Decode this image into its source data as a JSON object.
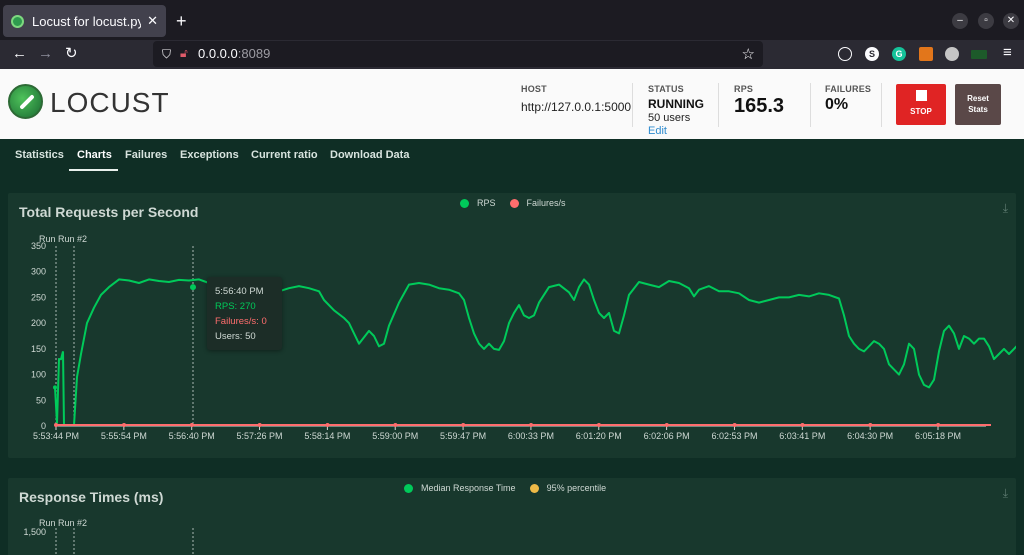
{
  "browser": {
    "tab_title": "Locust for locust.py",
    "tab_close": "✕",
    "new_tab": "+",
    "url_host": "0.0.0.0",
    "url_port": ":8089",
    "window_buttons": [
      "–",
      "▫",
      "✕"
    ]
  },
  "header": {
    "logo": "LOCUST",
    "host_label": "HOST",
    "host_value": "http://127.0.0.1:5000",
    "status_label": "STATUS",
    "status_value": "RUNNING",
    "users_value": "50 users",
    "edit_label": "Edit",
    "rps_label": "RPS",
    "rps_value": "165.3",
    "failures_label": "FAILURES",
    "failures_value": "0%",
    "stop_label": "STOP",
    "reset_label_1": "Reset",
    "reset_label_2": "Stats"
  },
  "tabs": [
    "Statistics",
    "Charts",
    "Failures",
    "Exceptions",
    "Current ratio",
    "Download Data"
  ],
  "active_tab": "Charts",
  "colors": {
    "rps": "#00ca5a",
    "failures": "#ff6d6d",
    "median": "#00ca5a",
    "p95": "#eeba47"
  },
  "chart_rps": {
    "title": "Total Requests per Second",
    "legend": [
      "RPS",
      "Failures/s"
    ],
    "markers": [
      "Run",
      "Run #2"
    ],
    "y_ticks": [
      "350",
      "300",
      "250",
      "200",
      "150",
      "100",
      "50",
      "0"
    ],
    "x_ticks": [
      "5:53:44 PM",
      "5:55:54 PM",
      "5:56:40 PM",
      "5:57:26 PM",
      "5:58:14 PM",
      "5:59:00 PM",
      "5:59:47 PM",
      "6:00:33 PM",
      "6:01:20 PM",
      "6:02:06 PM",
      "6:02:53 PM",
      "6:03:41 PM",
      "6:04:30 PM",
      "6:05:18 PM"
    ],
    "tooltip_time": "5:56:40 PM",
    "tooltip_rps": "RPS: 270",
    "tooltip_failures": "Failures/s: 0",
    "tooltip_users": "Users: 50"
  },
  "chart_data": {
    "type": "line",
    "ylim": [
      0,
      350
    ],
    "x": [
      "5:53:44 PM",
      "5:55:54 PM",
      "5:56:40 PM",
      "5:57:26 PM",
      "5:58:14 PM",
      "5:59:00 PM",
      "5:59:47 PM",
      "6:00:33 PM",
      "6:01:20 PM",
      "6:02:06 PM",
      "6:02:53 PM",
      "6:03:41 PM",
      "6:04:30 PM",
      "6:05:18 PM"
    ],
    "series": [
      {
        "name": "RPS",
        "values": [
          [
            0,
            75
          ],
          [
            1,
            5
          ],
          [
            2,
            130
          ],
          [
            3,
            130
          ],
          [
            4,
            145
          ],
          [
            5,
            2
          ],
          [
            6,
            3
          ],
          [
            7,
            2
          ],
          [
            8,
            2
          ],
          [
            9,
            2
          ],
          [
            10,
            2
          ],
          [
            11,
            2
          ],
          [
            12,
            2
          ],
          [
            13,
            2
          ],
          [
            14,
            2
          ],
          [
            15,
            2
          ],
          [
            16,
            2
          ],
          [
            17,
            2
          ],
          [
            18,
            2
          ],
          [
            19,
            2
          ],
          [
            20,
            2
          ],
          [
            21,
            2
          ],
          [
            22,
            2
          ],
          [
            23,
            2
          ],
          [
            24,
            2
          ],
          [
            25,
            2
          ],
          [
            26,
            2
          ],
          [
            27,
            2
          ],
          [
            28,
            2
          ],
          [
            29,
            2
          ],
          [
            30,
            2
          ],
          [
            31,
            2
          ],
          [
            32,
            2
          ],
          [
            33,
            2
          ],
          [
            34,
            2
          ],
          [
            35,
            2
          ],
          [
            36,
            2
          ],
          [
            37,
            2
          ],
          [
            38,
            2
          ],
          [
            39,
            2
          ],
          [
            40,
            2
          ],
          [
            41,
            2
          ],
          [
            42,
            2
          ],
          [
            43,
            2
          ],
          [
            44,
            2
          ],
          [
            45,
            2
          ],
          [
            46,
            2
          ],
          [
            47,
            2
          ],
          [
            48,
            2
          ],
          [
            49,
            2
          ],
          [
            50,
            2
          ],
          [
            51,
            2
          ],
          [
            52,
            2
          ],
          [
            53,
            2
          ],
          [
            54,
            2
          ],
          [
            55,
            2
          ],
          [
            56,
            2
          ],
          [
            57,
            2
          ],
          [
            58,
            2
          ],
          [
            59,
            2
          ],
          [
            60,
            2
          ],
          [
            61,
            2
          ],
          [
            62,
            2
          ],
          [
            63,
            2
          ],
          [
            64,
            2
          ],
          [
            65,
            2
          ],
          [
            66,
            2
          ],
          [
            67,
            2
          ],
          [
            68,
            2
          ],
          [
            69,
            2
          ],
          [
            70,
            2
          ],
          [
            71,
            2
          ],
          [
            72,
            2
          ],
          [
            73,
            2
          ],
          [
            74,
            2
          ],
          [
            75,
            2
          ],
          [
            76,
            2
          ],
          [
            77,
            2
          ],
          [
            78,
            2
          ],
          [
            79,
            2
          ]
        ],
        "points": [
          [
            5,
            2
          ],
          [
            8,
            95
          ],
          [
            12,
            140
          ],
          [
            18,
            200
          ],
          [
            25,
            230
          ],
          [
            32,
            255
          ],
          [
            40,
            270
          ],
          [
            50,
            285
          ],
          [
            60,
            283
          ],
          [
            70,
            278
          ],
          [
            80,
            285
          ],
          [
            90,
            282
          ],
          [
            100,
            280
          ],
          [
            110,
            284
          ],
          [
            120,
            283
          ],
          [
            130,
            285
          ],
          [
            140,
            278
          ],
          [
            150,
            272
          ],
          [
            160,
            275
          ],
          [
            170,
            282
          ],
          [
            180,
            270
          ],
          [
            190,
            262
          ],
          [
            200,
            258
          ],
          [
            210,
            262
          ],
          [
            220,
            268
          ],
          [
            230,
            272
          ],
          [
            240,
            268
          ],
          [
            250,
            262
          ],
          [
            255,
            245
          ],
          [
            265,
            225
          ],
          [
            275,
            210
          ],
          [
            280,
            200
          ],
          [
            290,
            160
          ],
          [
            300,
            185
          ],
          [
            305,
            175
          ],
          [
            310,
            155
          ],
          [
            315,
            160
          ],
          [
            320,
            195
          ],
          [
            330,
            240
          ],
          [
            340,
            275
          ],
          [
            350,
            278
          ],
          [
            360,
            275
          ],
          [
            370,
            268
          ],
          [
            380,
            265
          ],
          [
            390,
            258
          ],
          [
            395,
            245
          ],
          [
            400,
            210
          ],
          [
            405,
            180
          ],
          [
            410,
            160
          ],
          [
            415,
            150
          ],
          [
            420,
            160
          ],
          [
            425,
            150
          ],
          [
            430,
            148
          ],
          [
            435,
            165
          ],
          [
            440,
            200
          ],
          [
            445,
            220
          ],
          [
            450,
            235
          ],
          [
            455,
            215
          ],
          [
            460,
            210
          ],
          [
            465,
            215
          ],
          [
            470,
            240
          ],
          [
            480,
            270
          ],
          [
            490,
            275
          ],
          [
            500,
            260
          ],
          [
            505,
            245
          ],
          [
            510,
            270
          ],
          [
            515,
            285
          ],
          [
            520,
            275
          ],
          [
            525,
            245
          ],
          [
            530,
            220
          ],
          [
            535,
            210
          ],
          [
            540,
            220
          ],
          [
            545,
            185
          ],
          [
            550,
            180
          ],
          [
            555,
            215
          ],
          [
            560,
            255
          ],
          [
            570,
            280
          ],
          [
            580,
            275
          ],
          [
            590,
            270
          ],
          [
            600,
            282
          ],
          [
            610,
            278
          ],
          [
            620,
            268
          ],
          [
            625,
            252
          ],
          [
            630,
            265
          ],
          [
            640,
            272
          ],
          [
            650,
            262
          ],
          [
            660,
            262
          ],
          [
            670,
            258
          ],
          [
            680,
            245
          ],
          [
            690,
            240
          ],
          [
            700,
            245
          ],
          [
            710,
            250
          ],
          [
            720,
            250
          ],
          [
            730,
            255
          ],
          [
            740,
            252
          ],
          [
            750,
            258
          ],
          [
            760,
            255
          ],
          [
            770,
            248
          ],
          [
            775,
            215
          ],
          [
            780,
            175
          ],
          [
            785,
            160
          ],
          [
            790,
            150
          ],
          [
            795,
            145
          ],
          [
            800,
            155
          ],
          [
            805,
            165
          ],
          [
            810,
            160
          ],
          [
            815,
            150
          ],
          [
            820,
            120
          ],
          [
            825,
            110
          ],
          [
            830,
            100
          ],
          [
            835,
            120
          ],
          [
            840,
            160
          ],
          [
            845,
            150
          ],
          [
            850,
            100
          ],
          [
            855,
            80
          ],
          [
            860,
            75
          ],
          [
            865,
            90
          ],
          [
            870,
            145
          ],
          [
            875,
            185
          ],
          [
            880,
            195
          ],
          [
            885,
            180
          ],
          [
            890,
            150
          ],
          [
            895,
            175
          ],
          [
            900,
            170
          ],
          [
            905,
            160
          ],
          [
            910,
            170
          ],
          [
            915,
            170
          ],
          [
            920,
            155
          ],
          [
            925,
            130
          ],
          [
            930,
            140
          ],
          [
            935,
            150
          ],
          [
            940,
            140
          ],
          [
            945,
            150
          ],
          [
            950,
            160
          ],
          [
            955,
            140
          ],
          [
            960,
            150
          ],
          [
            965,
            160
          ],
          [
            970,
            165
          ],
          [
            975,
            160
          ],
          [
            980,
            165
          ]
        ],
        "color": "#00ca5a"
      },
      {
        "name": "Failures/s",
        "values": [
          0,
          0,
          0,
          0,
          0,
          0,
          0,
          0,
          0,
          0,
          0,
          0,
          0,
          0
        ],
        "color": "#ff6d6d"
      }
    ]
  },
  "chart_resp": {
    "title": "Response Times (ms)",
    "legend": [
      "Median Response Time",
      "95% percentile"
    ],
    "markers": [
      "Run",
      "Run #2"
    ],
    "y_tick_top": "1,500"
  }
}
